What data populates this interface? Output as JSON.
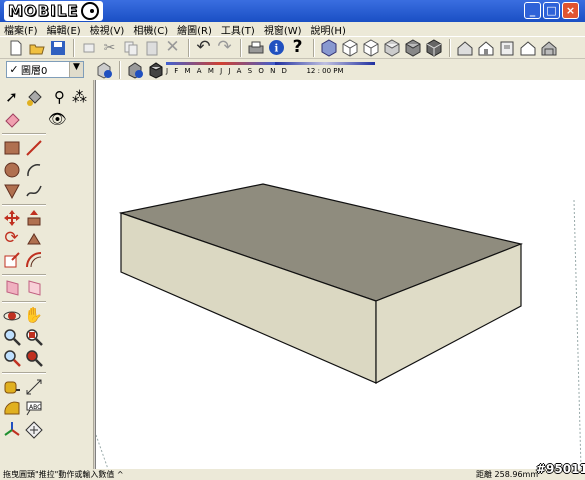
{
  "title_bar": {
    "logo_text": "MOBILE"
  },
  "menu": {
    "items": [
      "檔案(F)",
      "編輯(E)",
      "檢視(V)",
      "相機(C)",
      "繪圖(R)",
      "工具(T)",
      "視窗(W)",
      "說明(H)"
    ]
  },
  "toolbar": {
    "icons": [
      "new-file-icon",
      "open-file-icon",
      "save-icon",
      "erase-icon",
      "cut-icon",
      "copy-icon",
      "paste-icon",
      "delete-icon",
      "undo-icon",
      "redo-icon",
      "print-icon",
      "model-info-icon",
      "help-icon",
      "iso-view-icon",
      "top-view-icon",
      "front-view-icon",
      "right-view-icon",
      "back-view-icon",
      "left-view-icon",
      "house-icon",
      "house2-icon",
      "wall-icon",
      "house3-icon",
      "house4-icon"
    ]
  },
  "layers": {
    "current": "圖層0"
  },
  "shadow": {
    "months": "J F M A M J J A S O N D",
    "time": "12 : 00 PM"
  },
  "status": {
    "hint": "拖曳圓頭\"推拉\"動作或輸入數值 ^",
    "measure": "距離 258.96mm"
  },
  "watermark": "#95011"
}
